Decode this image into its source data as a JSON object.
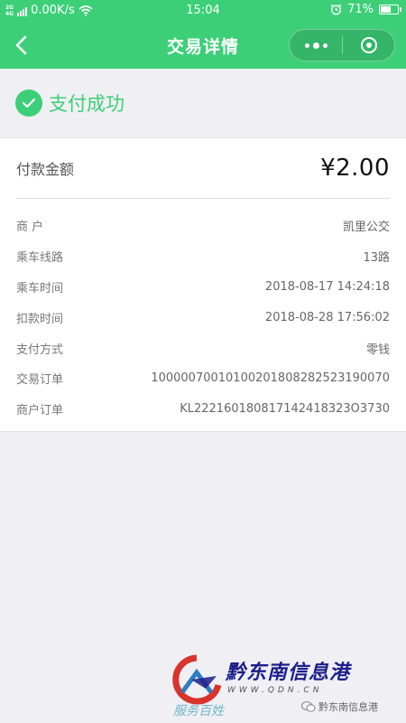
{
  "status_bar": {
    "network_top": "2G",
    "network_bottom": "4G",
    "speed": "0.00K/s",
    "time": "15:04",
    "battery": "71%",
    "battery_level": 0.71
  },
  "nav": {
    "title": "交易详情"
  },
  "success": {
    "text": "支付成功"
  },
  "amount": {
    "label": "付款金额",
    "value": "¥2.00"
  },
  "details": [
    {
      "label": "商 户",
      "value": "凯里公交"
    },
    {
      "label": "乘车线路",
      "value": "13路"
    },
    {
      "label": "乘车时间",
      "value": "2018-08-17 14:24:18"
    },
    {
      "label": "扣款时间",
      "value": "2018-08-28 17:56:02"
    },
    {
      "label": "支付方式",
      "value": "零钱"
    },
    {
      "label": "交易订单",
      "value": "10000070010100201808282523190070"
    },
    {
      "label": "商户订单",
      "value": "KL222160180817142418323O3730"
    }
  ],
  "watermark": {
    "name": "黔东南信息港",
    "url": "WWW.QDN.CN",
    "tag": "服务百姓",
    "badge": "黔东南信息港"
  },
  "colors": {
    "brand_green": "#3ccf78",
    "background": "#efeff4"
  }
}
